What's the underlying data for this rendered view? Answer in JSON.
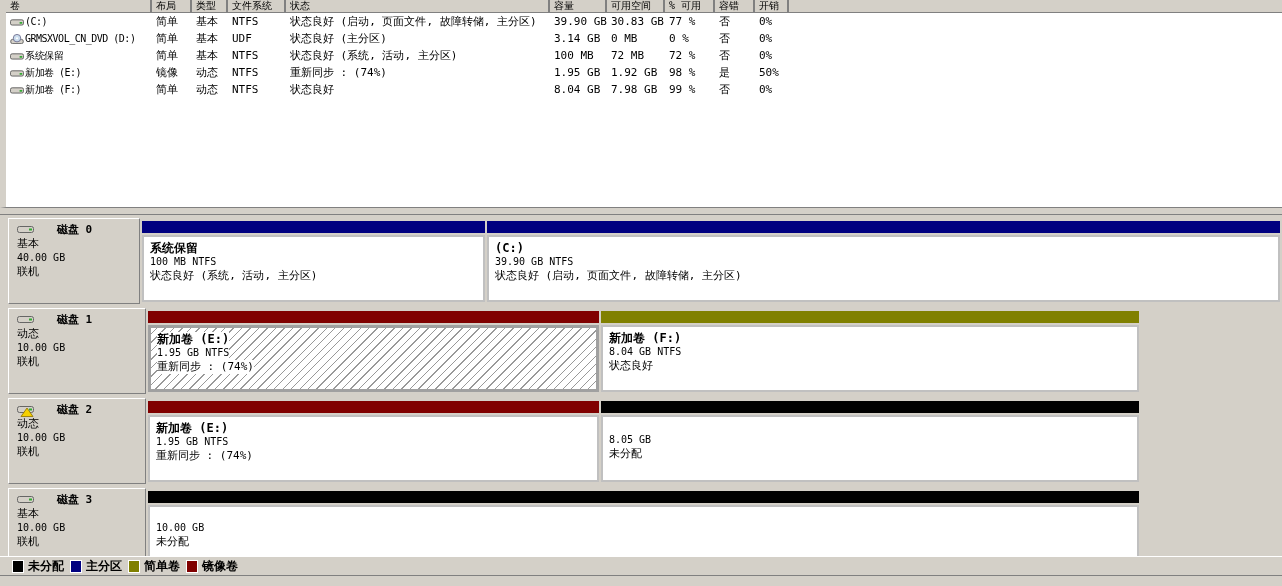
{
  "volume_table": {
    "columns": [
      "卷",
      "布局",
      "类型",
      "文件系统",
      "状态",
      "容量",
      "可用空间",
      "% 可用",
      "容错",
      "开销"
    ],
    "rows": [
      {
        "kind": "disk",
        "cells": [
          " (C:)",
          "简单",
          "基本",
          "NTFS",
          "状态良好 (启动, 页面文件, 故障转储, 主分区)",
          "39.90 GB",
          "30.83 GB",
          "77 %",
          "否",
          "0%"
        ]
      },
      {
        "kind": "dvd",
        "cells": [
          "GRMSXVOL_CN_DVD (D:)",
          "简单",
          "基本",
          "UDF",
          "状态良好 (主分区)",
          "3.14 GB",
          "0 MB",
          "0 %",
          "否",
          "0%"
        ]
      },
      {
        "kind": "disk",
        "cells": [
          "系统保留",
          "简单",
          "基本",
          "NTFS",
          "状态良好 (系统, 活动, 主分区)",
          "100 MB",
          "72 MB",
          "72 %",
          "否",
          "0%"
        ]
      },
      {
        "kind": "disk",
        "cells": [
          "新加卷 (E:)",
          "镜像",
          "动态",
          "NTFS",
          "重新同步 : (74%)",
          "1.95 GB",
          "1.92 GB",
          "98 %",
          "是",
          "50%"
        ]
      },
      {
        "kind": "disk",
        "cells": [
          "新加卷 (F:)",
          "简单",
          "动态",
          "NTFS",
          "状态良好",
          "8.04 GB",
          "7.98 GB",
          "99 %",
          "否",
          "0%"
        ]
      }
    ]
  },
  "disks": [
    {
      "name": "磁盘 0",
      "type": "基本",
      "size": "40.00 GB",
      "status": "联机",
      "warning": false,
      "partitions": [
        {
          "name": "系统保留",
          "detail": "100 MB NTFS",
          "status": "状态良好 (系统, 活动, 主分区)",
          "color": "#000080",
          "selected": false
        },
        {
          "name": "(C:)",
          "detail": "39.90 GB NTFS",
          "status": "状态良好 (启动, 页面文件, 故障转储, 主分区)",
          "color": "#000080",
          "selected": false
        }
      ]
    },
    {
      "name": "磁盘 1",
      "type": "动态",
      "size": "10.00 GB",
      "status": "联机",
      "warning": false,
      "partitions": [
        {
          "name": "新加卷  (E:)",
          "detail": "1.95 GB NTFS",
          "status": "重新同步 : (74%)",
          "color": "#800000",
          "selected": true
        },
        {
          "name": "新加卷  (F:)",
          "detail": "8.04 GB NTFS",
          "status": "状态良好",
          "color": "#808000",
          "selected": false
        }
      ]
    },
    {
      "name": "磁盘 2",
      "type": "动态",
      "size": "10.00 GB",
      "status": "联机",
      "warning": true,
      "partitions": [
        {
          "name": "新加卷  (E:)",
          "detail": "1.95 GB NTFS",
          "status": "重新同步 : (74%)",
          "color": "#800000",
          "selected": false
        },
        {
          "detail": "8.05 GB",
          "status": "未分配",
          "color": "#000000",
          "selected": false
        }
      ]
    },
    {
      "name": "磁盘 3",
      "type": "基本",
      "size": "10.00 GB",
      "status": "联机",
      "warning": false,
      "partitions": [
        {
          "detail": "10.00 GB",
          "status": "未分配",
          "color": "#000000",
          "selected": false
        }
      ]
    }
  ],
  "legend": [
    {
      "label": "未分配",
      "color": "#000000"
    },
    {
      "label": "主分区",
      "color": "#000080"
    },
    {
      "label": "简单卷",
      "color": "#808000"
    },
    {
      "label": "镜像卷",
      "color": "#800000"
    }
  ]
}
